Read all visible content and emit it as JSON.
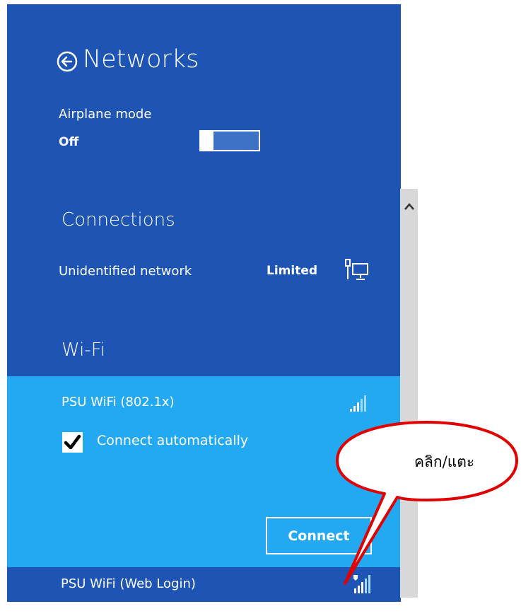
{
  "header": {
    "title": "Networks"
  },
  "airplane": {
    "label": "Airplane mode",
    "state": "Off"
  },
  "connections": {
    "heading": "Connections",
    "network_name": "Unidentified network",
    "network_status": "Limited"
  },
  "wifi": {
    "heading": "Wi-Fi",
    "selected_network": "PSU WiFi (802.1x)",
    "auto_label": "Connect automatically",
    "connect_label": "Connect",
    "other_network": "PSU WiFi (Web Login)"
  },
  "callout": {
    "text": "คลิก/แตะ"
  },
  "colors": {
    "panel": "#1e55b5",
    "selected": "#22a9f2",
    "callout_border": "#e00000"
  }
}
